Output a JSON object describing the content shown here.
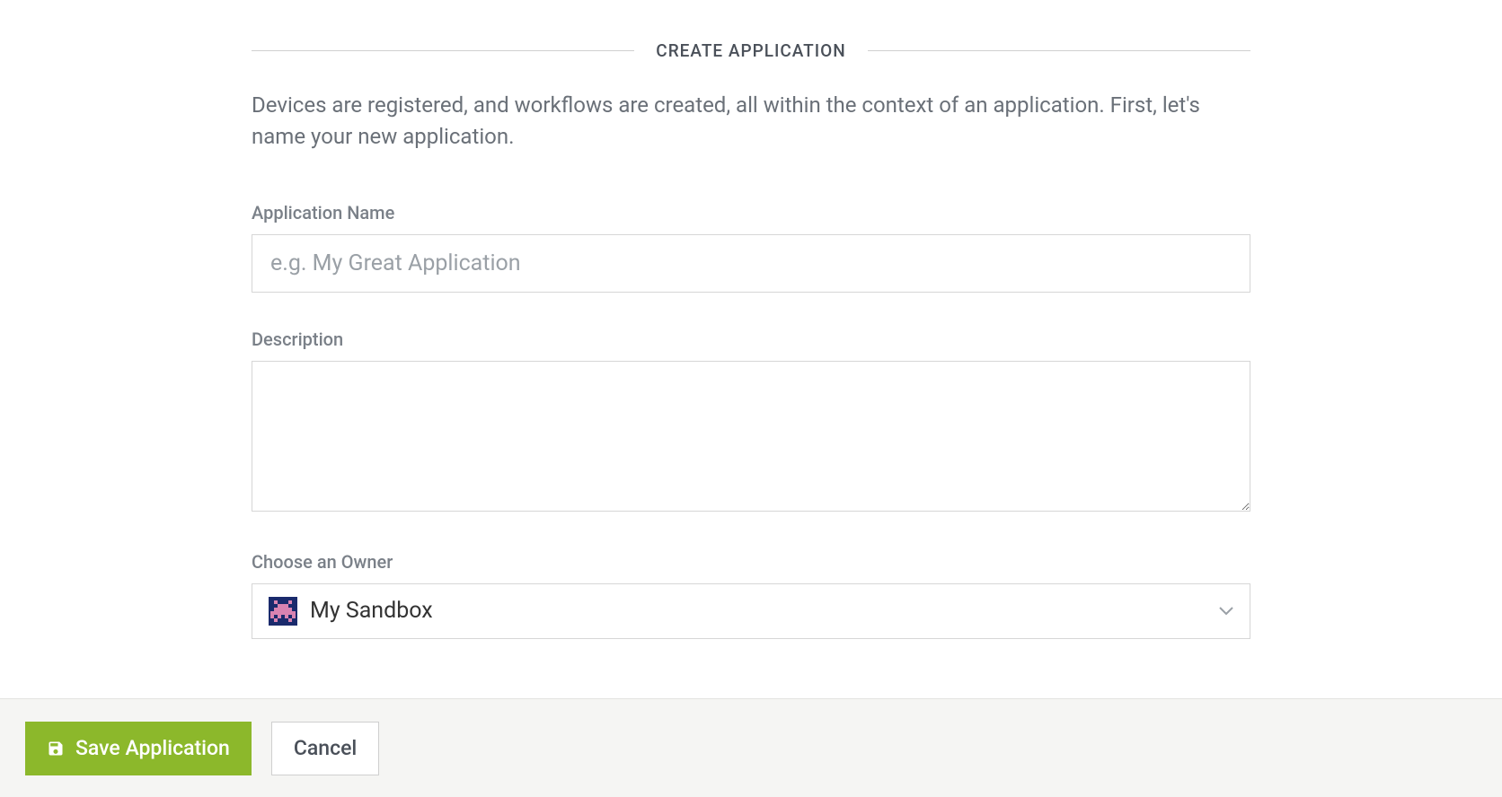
{
  "header": {
    "title": "CREATE APPLICATION"
  },
  "intro": "Devices are registered, and workflows are created, all within the context of an application. First, let's name your new application.",
  "form": {
    "name_label": "Application Name",
    "name_placeholder": "e.g. My Great Application",
    "name_value": "",
    "description_label": "Description",
    "description_value": "",
    "owner_label": "Choose an Owner",
    "owner_selected": "My Sandbox"
  },
  "actions": {
    "save_label": "Save Application",
    "cancel_label": "Cancel"
  },
  "colors": {
    "primary": "#8cb82b",
    "text_muted": "#7a8088"
  },
  "icons": {
    "owner_avatar": "space-invader-icon",
    "save": "save-icon",
    "dropdown": "caret-down-icon"
  }
}
